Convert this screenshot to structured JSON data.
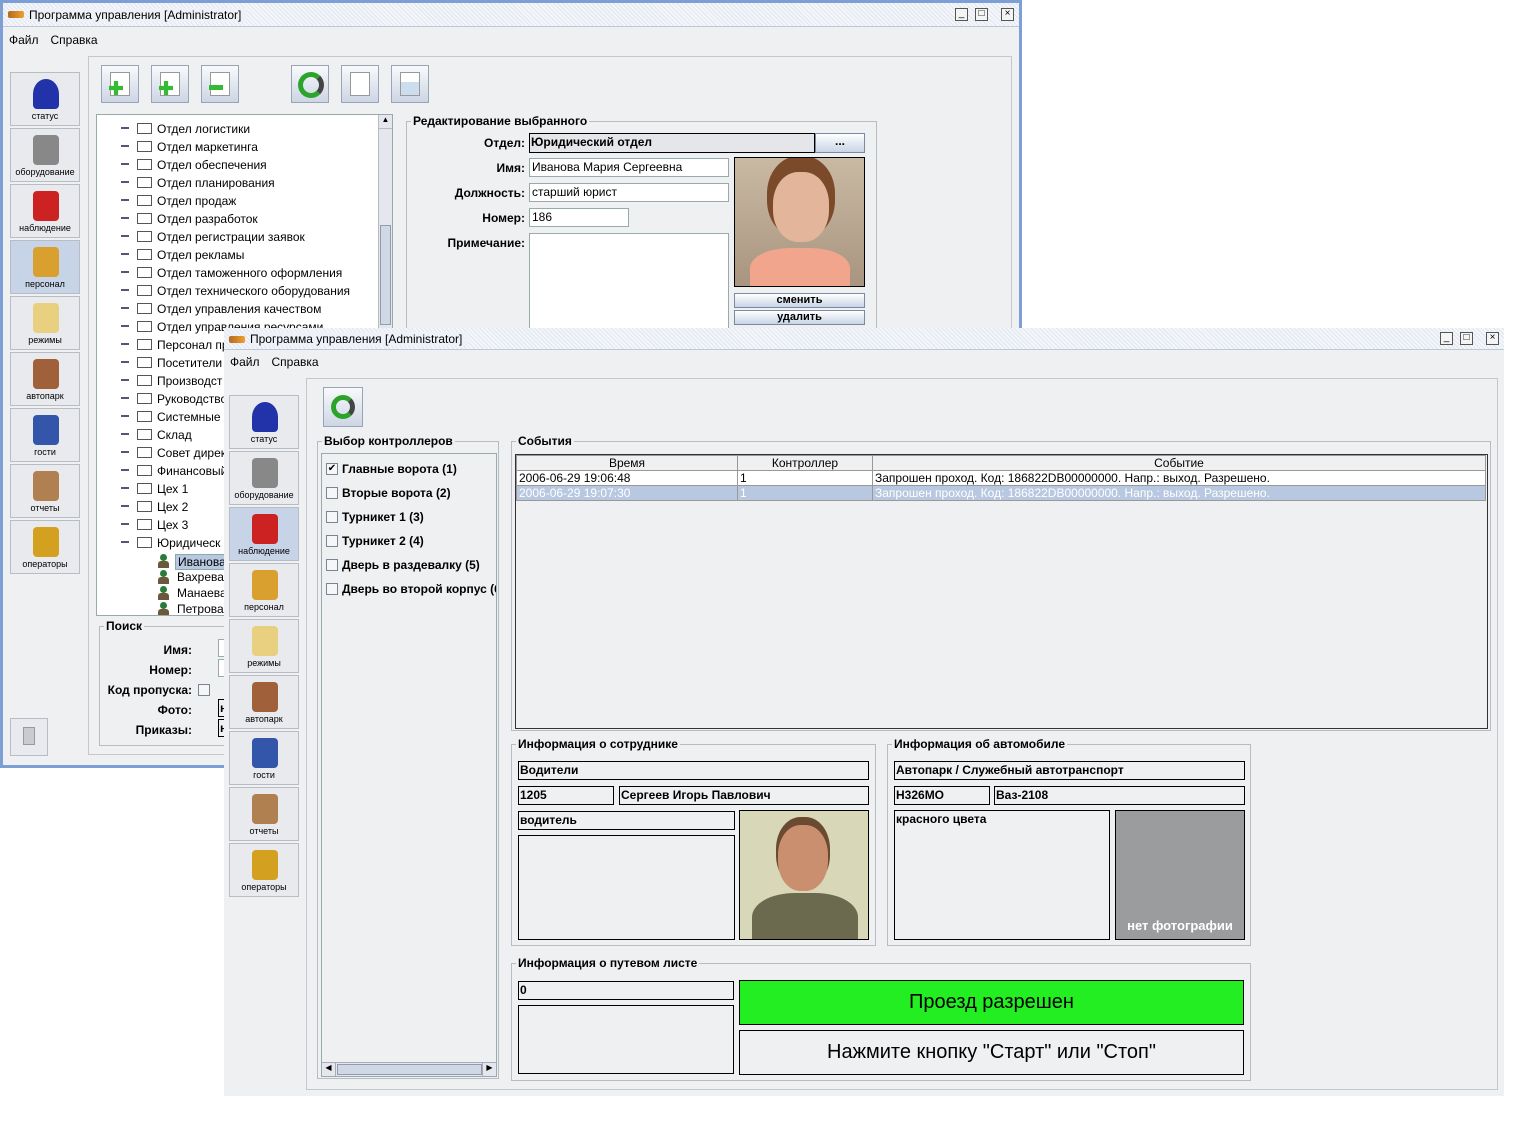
{
  "back_window": {
    "title": "Программа управления [Administrator]",
    "menu": [
      "Файл",
      "Справка"
    ],
    "toolbar": [
      {
        "icon": "add-folder-icon",
        "label": "Добавить отдел"
      },
      {
        "icon": "add-person-icon",
        "label": "Добавить сотрудника"
      },
      {
        "icon": "remove-icon",
        "label": "Удалить"
      },
      {
        "icon": "refresh-icon",
        "label": "Обновить"
      },
      {
        "icon": "id-card-icon",
        "label": "Пропуск"
      },
      {
        "icon": "excel-icon",
        "label": "Экспорт"
      }
    ],
    "tree": {
      "departments": [
        "Отдел логистики",
        "Отдел маркетинга",
        "Отдел обеспечения",
        "Отдел планирования",
        "Отдел продаж",
        "Отдел разработок",
        "Отдел регистрации заявок",
        "Отдел рекламы",
        "Отдел таможенного оформления",
        "Отдел технического оборудования",
        "Отдел управления качеством",
        "Отдел управления ресурсами",
        "Персонал пр",
        "Посетители",
        "Производст",
        "Руководство",
        "Системные",
        "Склад",
        "Совет дирек",
        "Финансовый",
        "Цех 1",
        "Цех 2",
        "Цех 3",
        "Юридическ"
      ],
      "employees": [
        "Иванова",
        "Вахрева",
        "Манаева",
        "Петрова"
      ],
      "selected_employee": "Иванова"
    },
    "search": {
      "title": "Поиск",
      "labels": [
        "Имя:",
        "Номер:",
        "Код пропуска:",
        "Фото:",
        "Приказы:"
      ],
      "photo_value": "н",
      "orders_value": "н"
    },
    "edit": {
      "title": "Редактирование выбранного",
      "department_label": "Отдел:",
      "department": "Юридический отдел",
      "browse_label": "...",
      "name_label": "Имя:",
      "name": "Иванова Мария Сергеевна",
      "position_label": "Должность:",
      "position": "старший юрист",
      "number_label": "Номер:",
      "number": "186",
      "note_label": "Примечание:",
      "note": "",
      "change_label": "сменить",
      "delete_label": "удалить"
    }
  },
  "sidebar": [
    {
      "label": "статус",
      "icon": "status-icon"
    },
    {
      "label": "оборудование",
      "icon": "equipment-icon"
    },
    {
      "label": "наблюдение",
      "icon": "monitoring-icon"
    },
    {
      "label": "персонал",
      "icon": "staff-icon"
    },
    {
      "label": "режимы",
      "icon": "modes-folder-icon"
    },
    {
      "label": "автопарк",
      "icon": "truck-icon"
    },
    {
      "label": "гости",
      "icon": "guests-icon"
    },
    {
      "label": "отчеты",
      "icon": "reports-icon"
    },
    {
      "label": "операторы",
      "icon": "key-icon"
    }
  ],
  "front_window": {
    "title": "Программа управления [Administrator]",
    "menu": [
      "Файл",
      "Справка"
    ],
    "controllers": {
      "title": "Выбор контроллеров",
      "items": [
        {
          "label": "Главные ворота (1)",
          "checked": true
        },
        {
          "label": "Вторые ворота (2)",
          "checked": false
        },
        {
          "label": "Турникет 1 (3)",
          "checked": false
        },
        {
          "label": "Турникет 2 (4)",
          "checked": false
        },
        {
          "label": "Дверь в раздевалку (5)",
          "checked": false
        },
        {
          "label": "Дверь во второй корпус (6",
          "checked": false
        }
      ]
    },
    "events": {
      "title": "События",
      "columns": [
        "Время",
        "Контроллер",
        "Событие"
      ],
      "rows": [
        [
          "2006-06-29 19:06:48",
          "1",
          "Запрошен проход. Код: 186822DB00000000. Напр.: выход. Разрешено."
        ],
        [
          "2006-06-29 19:07:30",
          "1",
          "Запрошен проход. Код: 186822DB00000000. Напр.: выход. Разрешено."
        ]
      ],
      "selected_row": 1
    },
    "employee": {
      "title": "Информация о сотруднике",
      "group": "Водители",
      "number": "1205",
      "name": "Сергеев Игорь Павлович",
      "position": "водитель",
      "note": ""
    },
    "car": {
      "title": "Информация об автомобиле",
      "group": "Автопарк / Служебный автотранспорт",
      "plate": "Н326МО",
      "model": "Ваз-2108",
      "note": "красного цвета",
      "no_photo": "нет фотографии"
    },
    "waybill": {
      "title": "Информация о путевом листе",
      "number": "0",
      "note": "",
      "status": "Проезд разрешен",
      "prompt": "Нажмите кнопку \"Старт\" или \"Стоп\""
    }
  },
  "colors": {
    "allowed": "#22ee22",
    "selection": "#b8c8e0",
    "window_border": "#7d9fd6"
  }
}
